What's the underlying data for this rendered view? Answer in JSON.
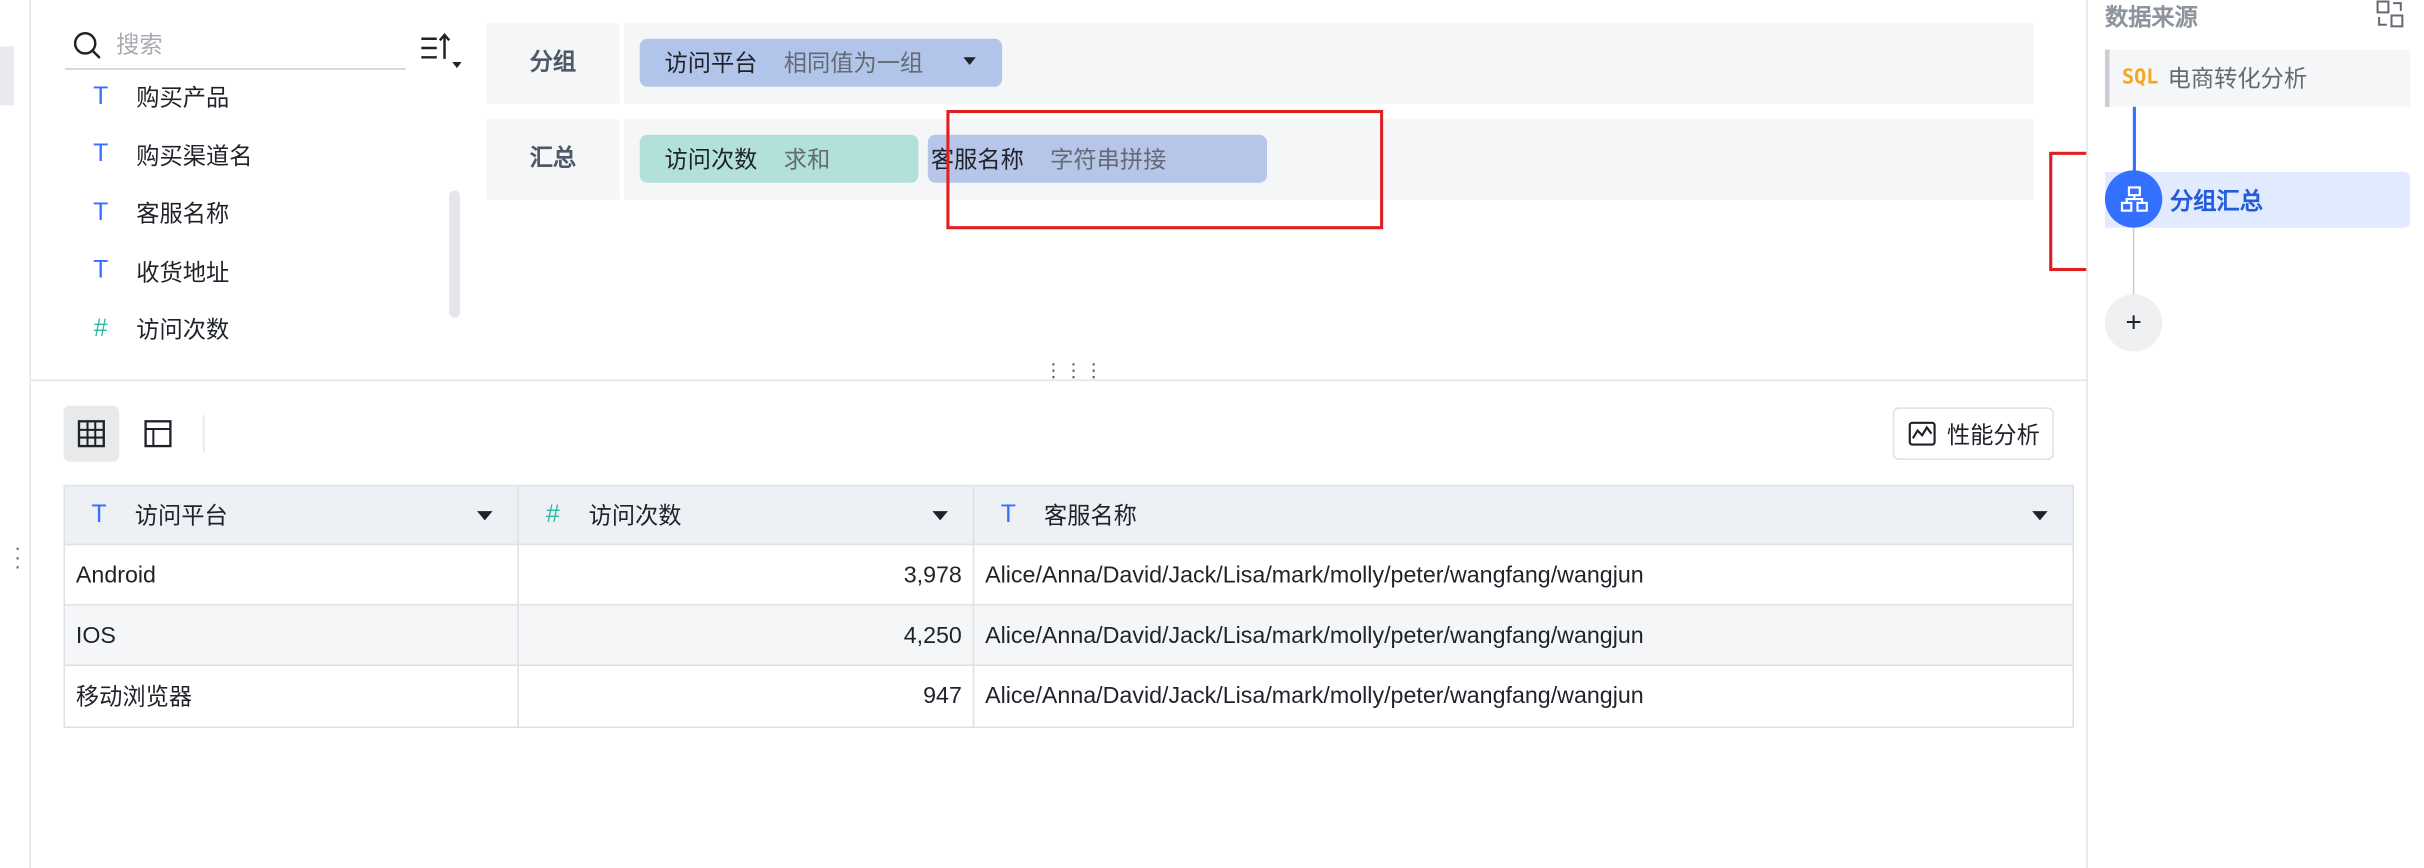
{
  "search": {
    "placeholder": "搜索",
    "value": ""
  },
  "fields": [
    {
      "type": "text",
      "name": "购买产品"
    },
    {
      "type": "text",
      "name": "购买渠道名"
    },
    {
      "type": "text",
      "name": "客服名称"
    },
    {
      "type": "text",
      "name": "收货地址"
    },
    {
      "type": "number",
      "name": "访问次数"
    }
  ],
  "config": {
    "group_label": "分组",
    "group_pill": {
      "field": "访问平台",
      "mode": "相同值为一组"
    },
    "summary_label": "汇总",
    "summary_pills": [
      {
        "field": "访问次数",
        "mode": "求和"
      },
      {
        "field": "客服名称",
        "mode": "字符串拼接"
      }
    ]
  },
  "toolbar": {
    "perf_label": "性能分析"
  },
  "table": {
    "columns": [
      {
        "type": "text",
        "name": "访问平台"
      },
      {
        "type": "number",
        "name": "访问次数"
      },
      {
        "type": "text",
        "name": "客服名称"
      }
    ],
    "rows": [
      [
        "Android",
        "3,978",
        "Alice/Anna/David/Jack/Lisa/mark/molly/peter/wangfang/wangjun"
      ],
      [
        "IOS",
        "4,250",
        "Alice/Anna/David/Jack/Lisa/mark/molly/peter/wangfang/wangjun"
      ],
      [
        "移动浏览器",
        "947",
        "Alice/Anna/David/Jack/Lisa/mark/molly/peter/wangfang/wangjun"
      ]
    ]
  },
  "right_panel": {
    "title": "数据来源",
    "source_node": {
      "icon": "SQL",
      "label": "电商转化分析"
    },
    "group_node": {
      "label": "分组汇总"
    },
    "add_label": "+"
  },
  "colors": {
    "accent": "#3370ff",
    "highlight_box": "#e02020",
    "pill_blue": "#b1c5ea",
    "pill_teal": "#b2e1dc"
  },
  "icons": {
    "text_type": "T",
    "number_type": "#"
  }
}
